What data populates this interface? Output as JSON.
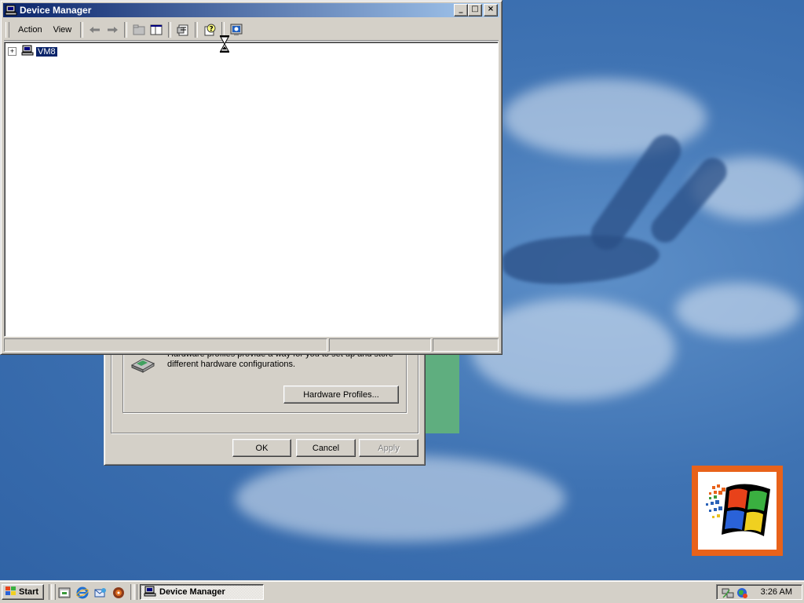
{
  "device_manager": {
    "title": "Device Manager",
    "menu": {
      "action": "Action",
      "view": "View"
    },
    "tree": {
      "root": "VM8",
      "expander": "+"
    }
  },
  "back_dialog": {
    "hw_profiles_text_line1": "Hardware profiles provide a way for you to set up and store",
    "hw_profiles_text_line2": "different hardware configurations.",
    "hw_profiles_button": "Hardware Profiles...",
    "ok_button": "OK",
    "cancel_button": "Cancel",
    "apply_button": "Apply"
  },
  "taskbar": {
    "start_label": "Start",
    "task_label": "Device Manager",
    "clock": "3:26 AM"
  },
  "colors": {
    "titlebar_start": "#0a246a",
    "titlebar_end": "#a6caf0",
    "desktop": "#3f73b3",
    "chrome": "#d4d0c8",
    "selection": "#0a246a"
  }
}
